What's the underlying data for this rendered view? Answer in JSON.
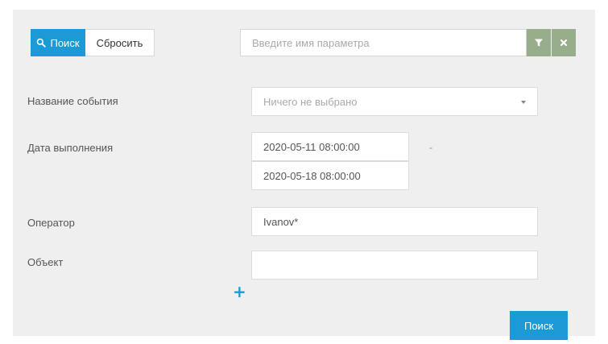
{
  "toolbar": {
    "search_label": "Поиск",
    "reset_label": "Сбросить",
    "param_placeholder": "Введите имя параметра",
    "filter_icon": "filter-icon",
    "clear_icon": "close-icon"
  },
  "form": {
    "event_name": {
      "label": "Название события",
      "value": "Ничего не выбрано"
    },
    "execution_date": {
      "label": "Дата выполнения",
      "from": "2020-05-11 08:00:00",
      "to": "2020-05-18 08:00:00",
      "separator": "-"
    },
    "operator": {
      "label": "Оператор",
      "value": "Ivanov*"
    },
    "object": {
      "label": "Объект",
      "value": ""
    },
    "add_icon": "plus-icon",
    "add_label": "+"
  },
  "footer": {
    "search_label": "Поиск"
  },
  "colors": {
    "accent": "#1b9ad6",
    "filter_bg": "#98ad8b",
    "panel_bg": "#efefef"
  }
}
